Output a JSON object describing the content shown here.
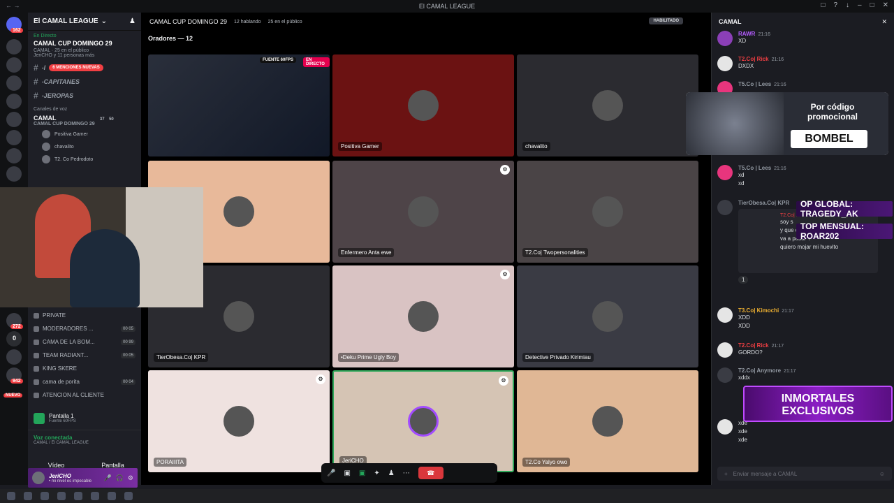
{
  "app": {
    "window_title": "El CAMAL LEAGUE"
  },
  "rail": {
    "badges": [
      "162",
      "272",
      "0",
      "942"
    ]
  },
  "sidebar": {
    "guild_name": "El CAMAL LEAGUE",
    "event": {
      "live_tag": "En Directo",
      "title": "CAMAL CUP DOMINGO 29",
      "stage_line": "CAMAL · 25 en el público",
      "participants_line": "JeriCHO y 11 personas más"
    },
    "text_channels": [
      {
        "name": "-I",
        "pill": "6 MENCIONES NUEVAS"
      },
      {
        "name": "-CAPITANES"
      },
      {
        "name": "-JEROPAS"
      }
    ],
    "voice_section_label": "Canales de voz",
    "voice_channel": {
      "name": "CAMAL",
      "subtitle": "CAMAL CUP DOMINGO 29",
      "count_a": "37",
      "count_b": "50"
    },
    "voice_users": [
      "Positiva Gamer",
      "chavalito",
      "T2. Co Pedrodoto"
    ],
    "bottom_channels": [
      {
        "name": "PRIVATE",
        "count": ""
      },
      {
        "name": "MODERADORES ...",
        "count": "00 05"
      },
      {
        "name": "CAMA DE LA BOM...",
        "count": "00 99"
      },
      {
        "name": "TEAM RADIANT...",
        "count": "00 05"
      },
      {
        "name": "KING SKERE",
        "count": ""
      },
      {
        "name": "cama de porita",
        "count": "00 04"
      },
      {
        "name": "ATENCION AL CLIENTE",
        "count": ""
      }
    ],
    "nuevo_label": "NUEVO",
    "screen_share": {
      "title": "Pantalla 1",
      "subtitle": "Fuente 60FPS"
    },
    "voice_status": {
      "title": "Voz conectada",
      "subtitle": "CAMAL / El CAMAL LEAGUE"
    },
    "video_label": "Vídeo",
    "screen_label": "Pantalla",
    "user": {
      "name": "JeriCHO",
      "status": "• mi nivel es impecable"
    }
  },
  "stage": {
    "title": "CAMAL CUP DOMINGO 29",
    "speaking": "12 hablando",
    "audience": "25 en el público",
    "enabled_label": "HABILITADO",
    "speakers_label": "Oradores — 12",
    "fuente_badge": "FUENTE 60FPS",
    "live_badge": "EN DIRECTO",
    "tiles": [
      {
        "name": "JeriCHO",
        "bg": "#1a1d24"
      },
      {
        "name": "Positiva Gamer",
        "bg": "#6b1212"
      },
      {
        "name": "chavalito",
        "bg": "#2b2b30"
      },
      {
        "name": "",
        "bg": "#e8b99a"
      },
      {
        "name": "Enfermero Anta ewe",
        "bg": "#4e4448"
      },
      {
        "name": "T2.Co| Twopersonalities",
        "bg": "#4a4446"
      },
      {
        "name": "TierObesa.Co| KPR",
        "bg": "#2b2b30"
      },
      {
        "name": "•Deku Prime Ugly Boy",
        "bg": "#d9c3c3"
      },
      {
        "name": "Detective Privado Kirimiau",
        "bg": "#3a3b44"
      },
      {
        "name": "PORAIIITA",
        "bg": "#efe2e0"
      },
      {
        "name": "JeriCHO",
        "bg": "#d5c4b4"
      },
      {
        "name": "T2.Co Yalyo owo",
        "bg": "#e0b795"
      }
    ]
  },
  "chat": {
    "channel": "CAMAL",
    "messages": [
      {
        "author": "RAWR",
        "time": "21:16",
        "lines": [
          "XD"
        ],
        "color": "#b45cff"
      },
      {
        "author": "T2.Co| Rick",
        "time": "21:16",
        "lines": [
          "DXDX"
        ],
        "color": "#f23f43"
      },
      {
        "author": "T5.Co | Lees",
        "time": "21:16",
        "lines": [],
        "color": "#dbdee1"
      },
      {
        "author": "T5.Co | Lees",
        "time": "21:16",
        "lines": [
          "xd",
          "xd"
        ],
        "color": "#dbdee1"
      },
      {
        "author": "TierObesa.Co| KPR",
        "time": "",
        "lines": [
          "soy s",
          "y que chucha",
          "va a pasar ?",
          "quiero mojar mi huevito"
        ],
        "color": "#dbdee1"
      },
      {
        "author": "T3.Co| Kimochi",
        "time": "21:17",
        "lines": [
          "XDD",
          "XDD"
        ],
        "color": "#f0b232"
      },
      {
        "author": "T2.Co| Rick",
        "time": "21:17",
        "lines": [
          "GORDO?"
        ],
        "color": "#f23f43"
      },
      {
        "author": "T2.Co| Anymore",
        "time": "21:17",
        "lines": [
          "xddx"
        ],
        "color": "#dbdee1"
      },
      {
        "author": "",
        "time": "",
        "lines": [
          "xde",
          "xde",
          "xde"
        ],
        "color": "#dbdee1"
      }
    ],
    "reply_to": "T2.Co| Rick",
    "reaction_count": "1",
    "input_placeholder": "Enviar mensaje a CAMAL"
  },
  "overlays": {
    "promo_line1": "Por código",
    "promo_line2": "promocional",
    "promo_code": "BOMBEL",
    "top_global": "OP GLOBAL: TRAGEDY_AK",
    "top_mensual": "TOP MENSUAL: ROAR202",
    "inmortales_1": "INMORTALES",
    "inmortales_2": "EXCLUSIVOS"
  }
}
